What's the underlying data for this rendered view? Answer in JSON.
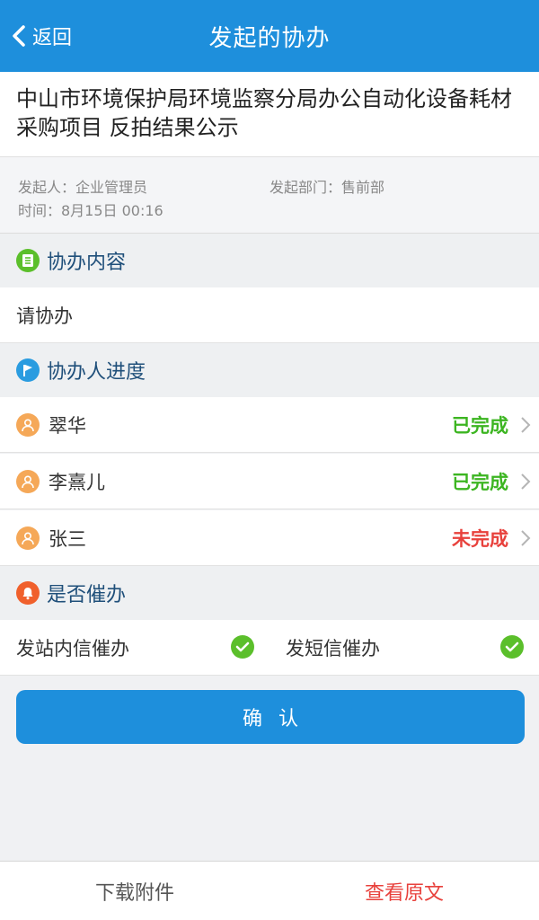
{
  "header": {
    "back_label": "返回",
    "title": "发起的协办"
  },
  "document": {
    "title": "中山市环境保护局环境监察分局办公自动化设备耗材采购项目 反拍结果公示",
    "initiator": "发起人：企业管理员",
    "department": "发起部门：售前部",
    "time": "时间：8月15日 00:16"
  },
  "content_section": {
    "label": "协办内容",
    "icon": "list-icon",
    "text": "请协办"
  },
  "progress_section": {
    "label": "协办人进度",
    "icon": "flag-icon",
    "people": [
      {
        "name": "翠华",
        "status": "已完成",
        "status_color": "#3cb521"
      },
      {
        "name": "李熹儿",
        "status": "已完成",
        "status_color": "#3cb521"
      },
      {
        "name": "张三",
        "status": "未完成",
        "status_color": "#e8413c"
      }
    ]
  },
  "remind_section": {
    "label": "是否催办",
    "icon": "bell-icon",
    "options": [
      {
        "label": "发站内信催办",
        "checked": true
      },
      {
        "label": "发短信催办",
        "checked": true
      }
    ]
  },
  "confirm_label": "确认",
  "bottom_bar": {
    "download_label": "下载附件",
    "view_original_label": "查看原文",
    "view_original_color": "#e8413c"
  },
  "colors": {
    "primary": "#1e8fdc",
    "done": "#3cb521",
    "pending": "#e8413c",
    "avatar": "#f5a858"
  }
}
